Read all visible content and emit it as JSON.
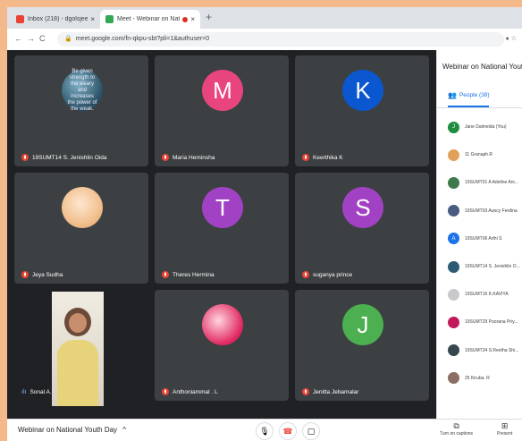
{
  "tabs": [
    {
      "label": "Inbox (218) - dgolsjeen@gmail.",
      "favicon_color": "#ea4335"
    },
    {
      "label": "Meet - Webinar on Nationa",
      "favicon_color": "#34a853"
    }
  ],
  "address": {
    "url": "meet.google.com/fn-qkpu-sbt?pli=1&authuser=0"
  },
  "tiles": [
    {
      "name": "19SUMT14 S. Jenishlin Oida",
      "type": "photo-a",
      "avatar_text": "Be given strength to the weary and increases the power of the weak.",
      "muted": true
    },
    {
      "name": "Maria Heminsha",
      "type": "letter",
      "letter": "M",
      "color": "#e8457f",
      "muted": true
    },
    {
      "name": "Keerthika K",
      "type": "letter",
      "letter": "K",
      "color": "#0b57d0",
      "muted": true
    },
    {
      "name": "Jeya Sudha",
      "type": "photo-b",
      "muted": true
    },
    {
      "name": "Theres Hermina",
      "type": "letter",
      "letter": "T",
      "color": "#a142c4",
      "muted": true
    },
    {
      "name": "suganya prince",
      "type": "letter",
      "letter": "S",
      "color": "#a142c4",
      "muted": true
    },
    {
      "name": "Sonal A. M",
      "type": "video",
      "muted": false
    },
    {
      "name": "Anthoniammal . L",
      "type": "photo-c",
      "muted": true
    },
    {
      "name": "Jenitta Jebamalar",
      "type": "letter",
      "letter": "J",
      "color": "#4caf50",
      "muted": true
    }
  ],
  "panel": {
    "title": "Webinar on National Youth",
    "tab_label": "People (38)",
    "people": [
      {
        "name": "Jane Dalmeida (You)",
        "avatar_color": "#1e8e3e",
        "initial": "J"
      },
      {
        "name": "11 Granaph.R",
        "avatar_color": "#e2a15b",
        "initial": ""
      },
      {
        "name": "19SUMT01 A Adeline Ani...",
        "avatar_color": "#3c7a4b",
        "initial": ""
      },
      {
        "name": "19SUMT03 Auncy Ferdina",
        "avatar_color": "#4a5a80",
        "initial": ""
      },
      {
        "name": "19SUMT06 Arthi S",
        "avatar_color": "#1a73e8",
        "initial": "A"
      },
      {
        "name": "19SUMT14 S. Jenishlin O...",
        "avatar_color": "#2d5b73",
        "initial": ""
      },
      {
        "name": "19SUMT16 K.KAVIYA",
        "avatar_color": "#c7c9cc",
        "initial": ""
      },
      {
        "name": "19SUMT29 Poorana Priy...",
        "avatar_color": "#c2185b",
        "initial": ""
      },
      {
        "name": "19SUMT34 S.Reetha Shi...",
        "avatar_color": "#37474f",
        "initial": ""
      },
      {
        "name": "25 Kiruba. R",
        "avatar_color": "#8d6e63",
        "initial": ""
      }
    ]
  },
  "bottom": {
    "meeting_title": "Webinar on National Youth Day",
    "caret": "^",
    "captions_label": "Turn on captions",
    "present_label": "Present"
  }
}
